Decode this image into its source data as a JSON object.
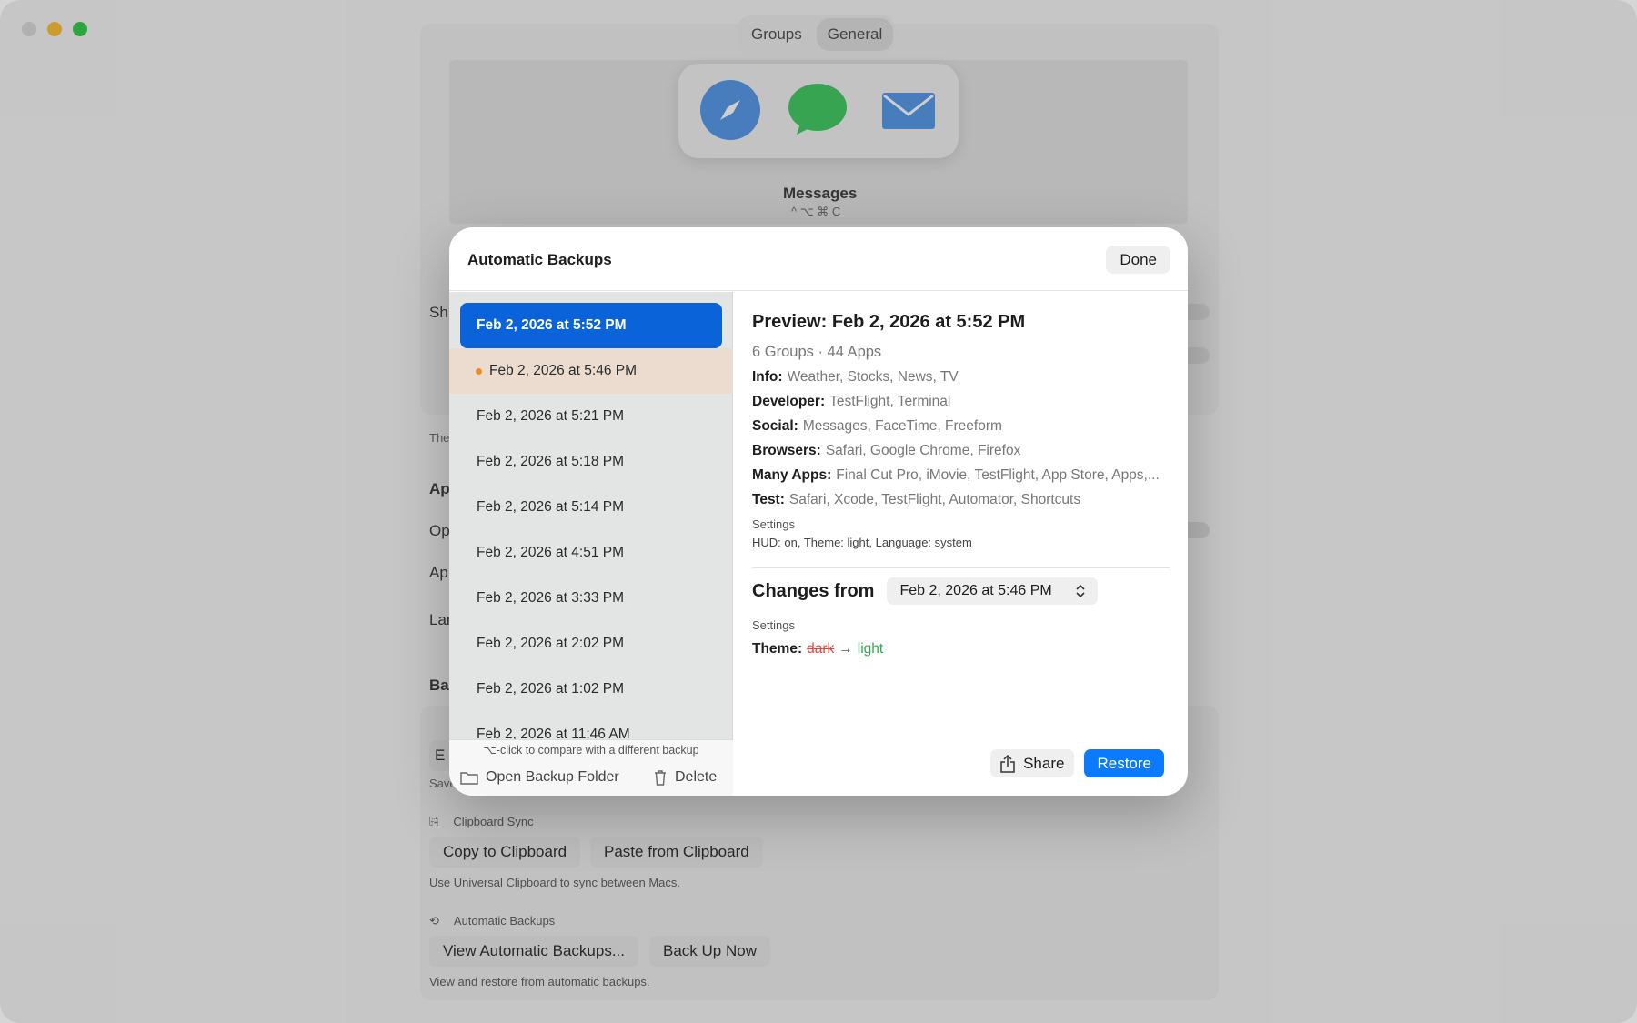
{
  "background": {
    "tabs": [
      "Groups",
      "General"
    ],
    "preview_app_label": "Messages",
    "preview_shortcut": "^ ⌥ ⌘ C",
    "clipped_labels": [
      "Sh",
      "The",
      "Ap",
      "Op",
      "Ap",
      "Lar",
      "Ba",
      "E",
      "Save"
    ],
    "clipboard_sync": {
      "title": "Clipboard Sync",
      "copy_label": "Copy to Clipboard",
      "paste_label": "Paste from Clipboard",
      "caption": "Use Universal Clipboard to sync between Macs."
    },
    "automatic_backups": {
      "title": "Automatic Backups",
      "view_label": "View Automatic Backups...",
      "backup_now_label": "Back Up Now",
      "caption": "View and restore from automatic backups."
    }
  },
  "modal": {
    "title": "Automatic Backups",
    "done_label": "Done",
    "backups": [
      "Feb 2, 2026 at 5:52 PM",
      "Feb 2, 2026 at 5:46 PM",
      "Feb 2, 2026 at 5:21 PM",
      "Feb 2, 2026 at 5:18 PM",
      "Feb 2, 2026 at 5:14 PM",
      "Feb 2, 2026 at 4:51 PM",
      "Feb 2, 2026 at 3:33 PM",
      "Feb 2, 2026 at 2:02 PM",
      "Feb 2, 2026 at 1:02 PM",
      "Feb 2, 2026 at 11:46 AM"
    ],
    "hint": "⌥-click to compare with a different backup",
    "open_folder_label": "Open Backup Folder",
    "delete_label": "Delete",
    "preview": {
      "title": "Preview: Feb 2, 2026 at 5:52 PM",
      "summary": "6 Groups · 44 Apps",
      "groups": [
        {
          "name": "Info:",
          "apps": "Weather, Stocks, News, TV"
        },
        {
          "name": "Developer:",
          "apps": "TestFlight, Terminal"
        },
        {
          "name": "Social:",
          "apps": "Messages, FaceTime, Freeform"
        },
        {
          "name": "Browsers:",
          "apps": "Safari, Google Chrome, Firefox"
        },
        {
          "name": "Many Apps:",
          "apps": "Final Cut Pro, iMovie, TestFlight, App Store, Apps,..."
        },
        {
          "name": "Test:",
          "apps": "Safari, Xcode, TestFlight, Automator, Shortcuts"
        }
      ],
      "settings_heading": "Settings",
      "settings_value": "HUD: on, Theme: light, Language: system"
    },
    "changes": {
      "label": "Changes from",
      "compare_value": "Feb 2, 2026 at 5:46 PM",
      "settings_heading": "Settings",
      "key": "Theme:",
      "old": "dark",
      "arrow": "→",
      "new": "light"
    },
    "share_label": "Share",
    "restore_label": "Restore"
  },
  "colors": {
    "accent": "#0a63d9",
    "restore": "#0a7bff",
    "compare_highlight": "#ecdcd0",
    "compare_dot": "#f08a24",
    "removed": "#e0463c",
    "added": "#2fa84f"
  }
}
